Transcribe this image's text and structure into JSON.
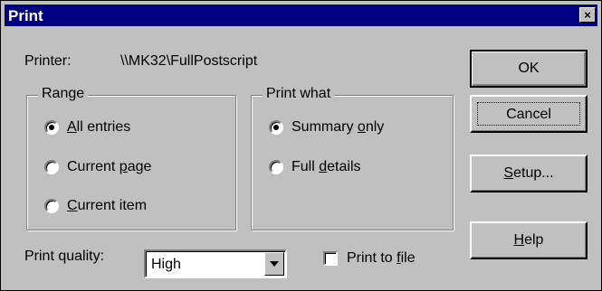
{
  "window": {
    "title": "Print",
    "close_glyph": "×"
  },
  "printer": {
    "label": "Printer:",
    "value": "\\\\MK32\\FullPostscript"
  },
  "range": {
    "title": "Range",
    "options": [
      {
        "pre": "",
        "mn": "A",
        "post": "ll entries",
        "checked": true
      },
      {
        "pre": "Current ",
        "mn": "p",
        "post": "age",
        "checked": false
      },
      {
        "pre": "",
        "mn": "C",
        "post": "urrent item",
        "checked": false
      }
    ]
  },
  "print_what": {
    "title": "Print what",
    "options": [
      {
        "pre": "Summary ",
        "mn": "o",
        "post": "nly",
        "checked": true
      },
      {
        "pre": "Full ",
        "mn": "d",
        "post": "etails",
        "checked": false
      }
    ]
  },
  "quality": {
    "label": "Print quality:",
    "value": "High"
  },
  "print_to_file": {
    "pre": "Print to ",
    "mn": "f",
    "post": "ile",
    "checked": false
  },
  "buttons": {
    "ok": "OK",
    "cancel": "Cancel",
    "setup": {
      "pre": "",
      "mn": "S",
      "post": "etup..."
    },
    "help": {
      "pre": "",
      "mn": "H",
      "post": "elp"
    }
  }
}
